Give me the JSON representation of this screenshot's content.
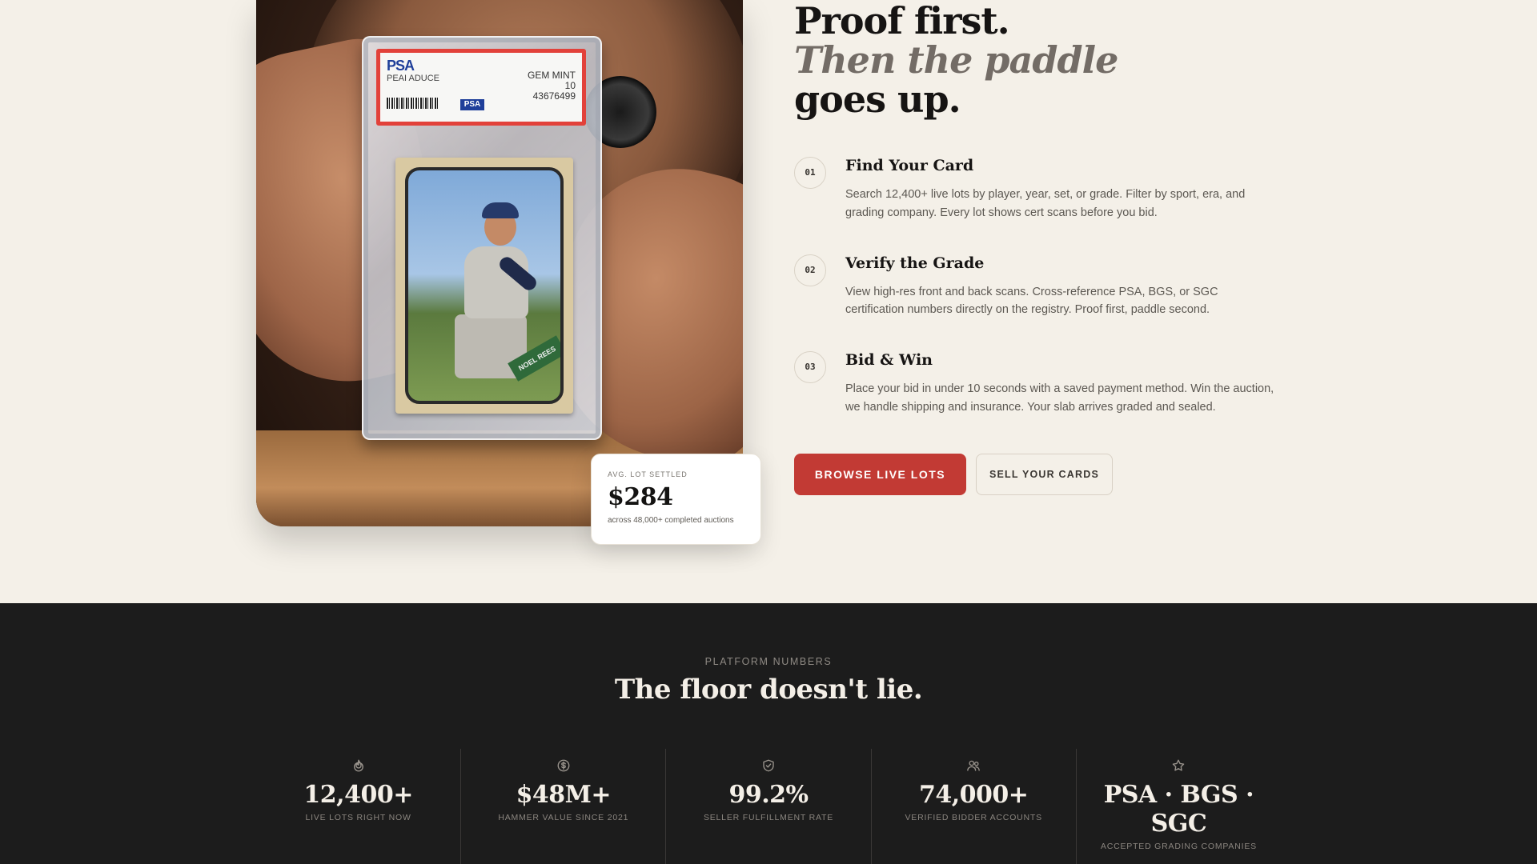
{
  "photo": {
    "slab_label": {
      "brand": "PSA",
      "player": "PEAI ADUCE",
      "grade_text": "GEM MINT",
      "grade_number": "10",
      "cert_number": "43676499",
      "logo_small": "PSA"
    },
    "card_nameplate": "NOEL REES"
  },
  "stat_card": {
    "label": "AVG. LOT SETTLED",
    "value": "$284",
    "sub": "across 48,000+ completed auctions"
  },
  "hero": {
    "line1": "Proof first.",
    "line2": "Then the paddle",
    "line3": "goes up."
  },
  "steps": [
    {
      "num": "01",
      "title": "Find Your Card",
      "desc": "Search 12,400+ live lots by player, year, set, or grade. Filter by sport, era, and grading company. Every lot shows cert scans before you bid."
    },
    {
      "num": "02",
      "title": "Verify the Grade",
      "desc": "View high-res front and back scans. Cross-reference PSA, BGS, or SGC certification numbers directly on the registry. Proof first, paddle second."
    },
    {
      "num": "03",
      "title": "Bid & Win",
      "desc": "Place your bid in under 10 seconds with a saved payment method. Win the auction, we handle shipping and insurance. Your slab arrives graded and sealed."
    }
  ],
  "buttons": {
    "primary": "BROWSE LIVE LOTS",
    "secondary": "SELL YOUR CARDS"
  },
  "platform": {
    "eyebrow": "PLATFORM NUMBERS",
    "title": "The floor doesn't lie.",
    "metrics": [
      {
        "icon": "flame-icon",
        "value": "12,400+",
        "label": "LIVE LOTS RIGHT NOW"
      },
      {
        "icon": "dollar-icon",
        "value": "$48M+",
        "label": "HAMMER VALUE SINCE 2021"
      },
      {
        "icon": "shield-check-icon",
        "value": "99.2%",
        "label": "SELLER FULFILLMENT RATE"
      },
      {
        "icon": "users-icon",
        "value": "74,000+",
        "label": "VERIFIED BIDDER ACCOUNTS"
      },
      {
        "icon": "star-icon",
        "value": "PSA · BGS · SGC",
        "label": "ACCEPTED GRADING COMPANIES"
      }
    ]
  },
  "colors": {
    "page_bg": "#f4f0e8",
    "dark_bg": "#1c1c1c",
    "accent_red": "#c23a34",
    "heading_dark": "#161413",
    "heading_muted": "#736c66"
  }
}
